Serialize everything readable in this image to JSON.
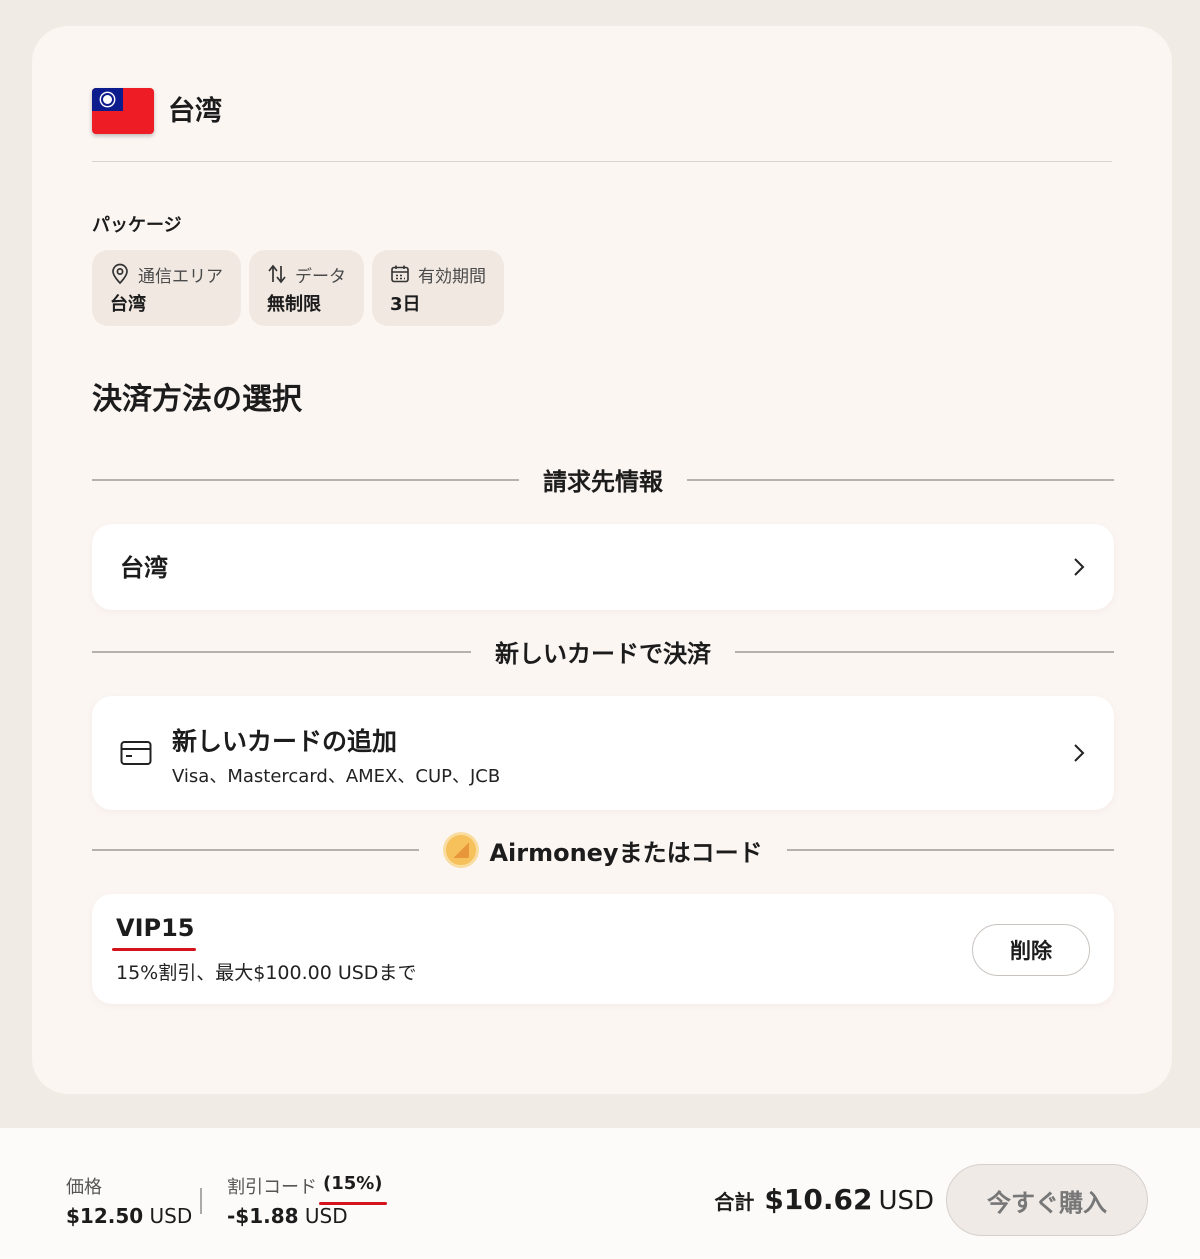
{
  "header": {
    "country": "台湾"
  },
  "package": {
    "label": "パッケージ",
    "chips": [
      {
        "icon": "location-pin-icon",
        "title": "通信エリア",
        "value": "台湾"
      },
      {
        "icon": "data-arrows-icon",
        "title": "データ",
        "value": "無制限"
      },
      {
        "icon": "calendar-icon",
        "title": "有効期間",
        "value": "3日"
      }
    ]
  },
  "payment": {
    "title": "決済方法の選択",
    "billing_divider": "請求先情報",
    "billing_region": "台湾",
    "newcard_divider": "新しいカードで決済",
    "newcard_title": "新しいカードの追加",
    "newcard_brands": "Visa、Mastercard、AMEX、CUP、JCB",
    "airmoney_divider": "Airmoneyまたはコード",
    "code": {
      "name": "VIP15",
      "description": "15%割引、最大$100.00 USDまで",
      "remove_label": "削除"
    }
  },
  "footer": {
    "price_label": "価格",
    "price_value": "$12.50",
    "price_currency": "USD",
    "discount_label": "割引コード",
    "discount_pct": "(15%)",
    "discount_value": "-$1.88",
    "discount_currency": "USD",
    "total_label": "合計",
    "total_value": "$10.62",
    "total_currency": "USD",
    "buy_label": "今すぐ購入"
  },
  "colors": {
    "accent_red": "#d4131c",
    "card_bg": "#fcf6f3",
    "page_bg": "#f1ebe5"
  }
}
